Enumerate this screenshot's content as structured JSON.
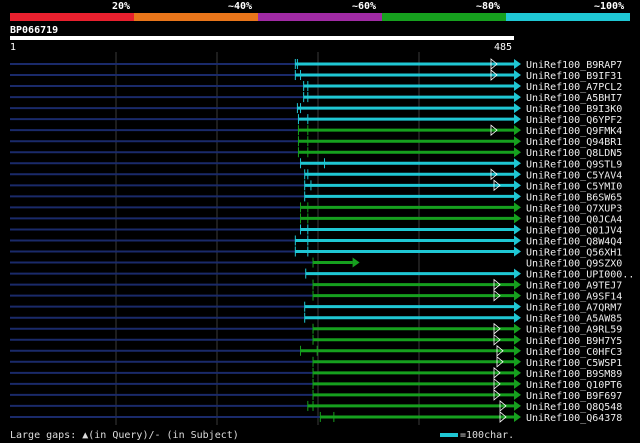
{
  "legend": {
    "labels": [
      "20%",
      "~40%",
      "~60%",
      "~80%",
      "~100%"
    ],
    "colors": [
      "#e8202e",
      "#e8751a",
      "#a02aa4",
      "#16a01e",
      "#1fc7d4"
    ]
  },
  "query": {
    "name": "BP066719",
    "start": "1",
    "end": "485",
    "length": 485
  },
  "hits": [
    {
      "name": "UniRef100_B9RAP7",
      "color": "#1fc7d4",
      "start": 275,
      "end": 485,
      "gaps": [
        275,
        277
      ],
      "arrow": 1
    },
    {
      "name": "UniRef100_B9IF31",
      "color": "#1fc7d4",
      "start": 275,
      "end": 485,
      "gaps": [
        275,
        280
      ],
      "arrow": 1
    },
    {
      "name": "UniRef100_A7PCL2",
      "color": "#1fc7d4",
      "start": 283,
      "end": 485,
      "gaps": [
        283,
        287
      ],
      "arrow": 0
    },
    {
      "name": "UniRef100_A5BHI7",
      "color": "#1fc7d4",
      "start": 283,
      "end": 485,
      "gaps": [
        283,
        287
      ],
      "arrow": 0
    },
    {
      "name": "UniRef100_B9I3K0",
      "color": "#1fc7d4",
      "start": 277,
      "end": 485,
      "gaps": [
        277,
        280
      ],
      "arrow": 0
    },
    {
      "name": "UniRef100_Q6YPF2",
      "color": "#1fc7d4",
      "start": 278,
      "end": 485,
      "gaps": [
        278,
        287
      ],
      "arrow": 0
    },
    {
      "name": "UniRef100_Q9FMK4",
      "color": "#16a01e",
      "start": 278,
      "end": 485,
      "gaps": [
        278,
        287
      ],
      "arrow": 1
    },
    {
      "name": "UniRef100_Q94BR1",
      "color": "#16a01e",
      "start": 278,
      "end": 485,
      "gaps": [
        278,
        287
      ],
      "arrow": 0
    },
    {
      "name": "UniRef100_Q8LDN5",
      "color": "#16a01e",
      "start": 278,
      "end": 485,
      "gaps": [
        278,
        287
      ],
      "arrow": 0
    },
    {
      "name": "UniRef100_Q9STL9",
      "color": "#1fc7d4",
      "start": 280,
      "end": 485,
      "gaps": [
        280,
        303
      ],
      "arrow": 0
    },
    {
      "name": "UniRef100_C5YAV4",
      "color": "#1fc7d4",
      "start": 284,
      "end": 485,
      "gaps": [
        284,
        287
      ],
      "arrow": 1
    },
    {
      "name": "UniRef100_C5YMI0",
      "color": "#1fc7d4",
      "start": 284,
      "end": 485,
      "gaps": [
        284,
        290
      ],
      "arrow": 2
    },
    {
      "name": "UniRef100_B6SW65",
      "color": "#1fc7d4",
      "start": 284,
      "end": 485,
      "gaps": [
        284
      ],
      "arrow": 0
    },
    {
      "name": "UniRef100_Q7XUP3",
      "color": "#16a01e",
      "start": 280,
      "end": 485,
      "gaps": [
        280,
        287
      ],
      "arrow": 0
    },
    {
      "name": "UniRef100_Q0JCA4",
      "color": "#16a01e",
      "start": 280,
      "end": 485,
      "gaps": [
        280,
        287
      ],
      "arrow": 0
    },
    {
      "name": "UniRef100_Q01JV4",
      "color": "#1fc7d4",
      "start": 280,
      "end": 485,
      "gaps": [
        280,
        287
      ],
      "arrow": 0
    },
    {
      "name": "UniRef100_Q8W4Q4",
      "color": "#1fc7d4",
      "start": 275,
      "end": 485,
      "gaps": [
        275,
        287
      ],
      "arrow": 0
    },
    {
      "name": "UniRef100_Q56XH1",
      "color": "#1fc7d4",
      "start": 275,
      "end": 485,
      "gaps": [
        275,
        287
      ],
      "arrow": 0
    },
    {
      "name": "UniRef100_Q9SZX0",
      "color": "#16a01e",
      "start": 292,
      "end": 330,
      "gaps": [
        292
      ],
      "arrow": 0
    },
    {
      "name": "UniRef100_UPI000..",
      "color": "#1fc7d4",
      "start": 285,
      "end": 485,
      "gaps": [
        285
      ],
      "arrow": 0
    },
    {
      "name": "UniRef100_A9TEJ7",
      "color": "#16a01e",
      "start": 292,
      "end": 485,
      "gaps": [
        292
      ],
      "arrow": 2
    },
    {
      "name": "UniRef100_A9SF14",
      "color": "#16a01e",
      "start": 292,
      "end": 485,
      "gaps": [
        292
      ],
      "arrow": 2
    },
    {
      "name": "UniRef100_A7QRM7",
      "color": "#1fc7d4",
      "start": 284,
      "end": 485,
      "gaps": [
        284
      ],
      "arrow": 0
    },
    {
      "name": "UniRef100_A5AW85",
      "color": "#1fc7d4",
      "start": 284,
      "end": 485,
      "gaps": [
        284
      ],
      "arrow": 0
    },
    {
      "name": "UniRef100_A9RL59",
      "color": "#16a01e",
      "start": 292,
      "end": 485,
      "gaps": [
        292
      ],
      "arrow": 2
    },
    {
      "name": "UniRef100_B9H7Y5",
      "color": "#16a01e",
      "start": 292,
      "end": 485,
      "gaps": [
        292
      ],
      "arrow": 2
    },
    {
      "name": "UniRef100_C0HFC3",
      "color": "#16a01e",
      "start": 280,
      "end": 485,
      "gaps": [
        280,
        296
      ],
      "arrow": 3
    },
    {
      "name": "UniRef100_C5WSP1",
      "color": "#16a01e",
      "start": 292,
      "end": 485,
      "gaps": [
        292
      ],
      "arrow": 3
    },
    {
      "name": "UniRef100_B9SM89",
      "color": "#16a01e",
      "start": 292,
      "end": 485,
      "gaps": [
        292
      ],
      "arrow": 2
    },
    {
      "name": "UniRef100_Q10PT6",
      "color": "#16a01e",
      "start": 292,
      "end": 485,
      "gaps": [
        292
      ],
      "arrow": 2
    },
    {
      "name": "UniRef100_B9F697",
      "color": "#16a01e",
      "start": 292,
      "end": 485,
      "gaps": [
        292
      ],
      "arrow": 2
    },
    {
      "name": "UniRef100_Q8Q548",
      "color": "#16a01e",
      "start": 287,
      "end": 485,
      "gaps": [
        287,
        292
      ],
      "arrow": 4
    },
    {
      "name": "UniRef100_Q64378",
      "color": "#16a01e",
      "start": 299,
      "end": 485,
      "gaps": [
        299,
        312
      ],
      "arrow": 4
    }
  ],
  "footer": {
    "gaps_text": "Large gaps: ▲(in Query)/- (in Subject)",
    "scale_text": "=100char."
  }
}
